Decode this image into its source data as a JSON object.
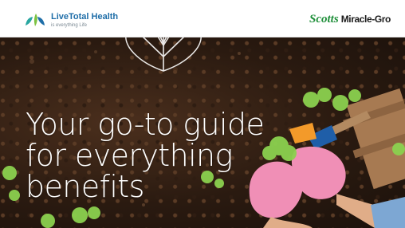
{
  "header": {
    "left_logo": {
      "name": "LiveTotal Health",
      "tagline": "is everything Life",
      "icon": "leaf-cluster-logo"
    },
    "right_logo": {
      "brand_part1": "Scotts",
      "brand_part2": "Miracle-Gro"
    }
  },
  "hero": {
    "headline_lines": [
      "Your go-to guide",
      "for everything",
      "benefits"
    ],
    "imagery": [
      "soil-background",
      "lettuce-seedlings",
      "gloved-hands",
      "trowel",
      "wooden-crate",
      "heart-leaf-outline"
    ]
  },
  "colors": {
    "brand_blue": "#1f6ea8",
    "brand_green": "#1f8f3a",
    "soil_dark": "#2a1a10",
    "glove_pink": "#f08fb6",
    "lettuce_green": "#8bd14f"
  }
}
